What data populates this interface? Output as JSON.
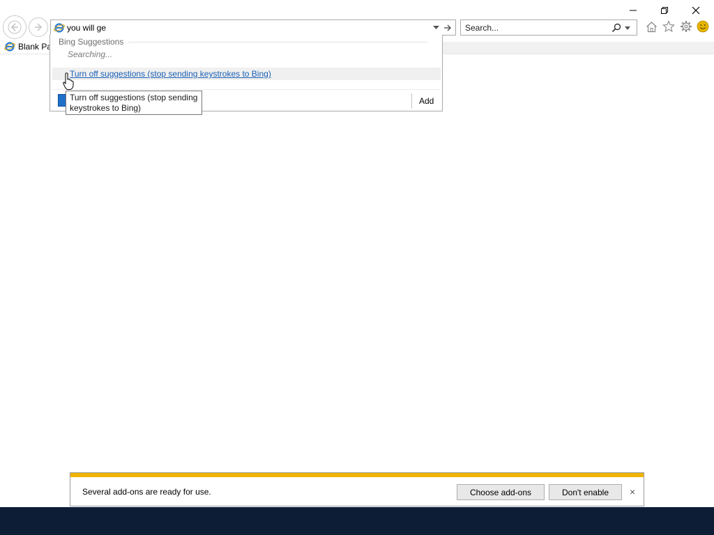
{
  "address_bar": {
    "value": "you will ge",
    "page_icon": "ie-page-icon",
    "dropdown_icon": "chevron-down-icon",
    "go_icon": "arrow-right-icon"
  },
  "search_box": {
    "placeholder": "Search...",
    "search_icon": "magnifier-icon",
    "dropdown_icon": "chevron-down-icon"
  },
  "tab": {
    "title": "Blank Pa",
    "icon": "ie-page-icon"
  },
  "suggestions": {
    "header": "Bing Suggestions",
    "status": "Searching...",
    "turn_off_link": "Turn off suggestions (stop sending keystrokes to Bing)",
    "add_label": "Add"
  },
  "tooltip": {
    "line1": "Turn off suggestions (stop sending",
    "line2": "keystrokes to Bing)"
  },
  "notification": {
    "message": "Several add-ons are ready for use.",
    "choose_button": "Choose add-ons",
    "dont_enable_button": "Don't enable",
    "close_glyph": "×"
  },
  "toolbar_icons": [
    "home-icon",
    "favorites-star-icon",
    "tools-gear-icon",
    "feedback-smiley-icon"
  ],
  "colors": {
    "notification_strip": "#f0b400",
    "link": "#1a5fb4",
    "taskbar": "#0d1d36",
    "smiley": "#e6b400"
  }
}
